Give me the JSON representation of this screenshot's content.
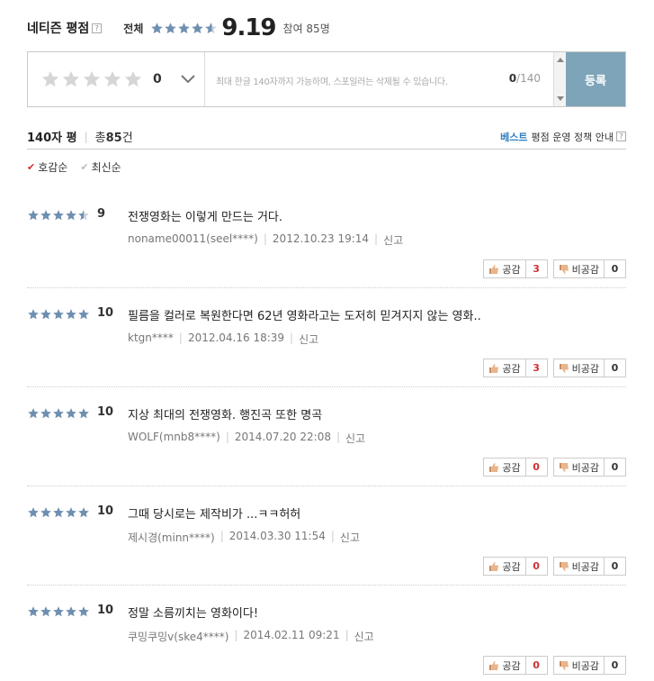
{
  "header": {
    "title": "네티즌 평점",
    "help": "?",
    "overall_label": "전체",
    "overall_stars": 4.6,
    "score": "9.19",
    "participants": "참여 85명"
  },
  "input": {
    "rating_value": "0",
    "placeholder": "최대 한글 140자까지 가능하며, 스포일러는 삭제될 수 있습니다.",
    "count_current": "0",
    "count_max": "/140",
    "submit_label": "등록"
  },
  "info": {
    "type": "140자 평",
    "total_prefix": "총",
    "total_count": "85",
    "total_suffix": "건",
    "best": "베스트",
    "policy": "평점 운영 정책 안내",
    "help": "?"
  },
  "sort": {
    "recommended": "호감순",
    "latest": "최신순"
  },
  "colors": {
    "star_filled": "#6e8fb0",
    "star_empty": "#c8d2dc",
    "submit_bg": "#7da4b8",
    "accent_red": "#d03030",
    "best_blue": "#2e7fc1"
  },
  "reviews": [
    {
      "stars": 4.5,
      "score": "9",
      "text": "전쟁영화는 이렇게 만드는 거다.",
      "author": "noname00011(seel****)",
      "date": "2012.10.23 19:14",
      "report": "신고",
      "like_label": "공감",
      "like_count": "3",
      "dislike_label": "비공감",
      "dislike_count": "0"
    },
    {
      "stars": 5,
      "score": "10",
      "text": "필름을 컬러로 복원한다면 62년 영화라고는 도저히 믿겨지지 않는 영화..",
      "author": "ktgn****",
      "date": "2012.04.16 18:39",
      "report": "신고",
      "like_label": "공감",
      "like_count": "3",
      "dislike_label": "비공감",
      "dislike_count": "0"
    },
    {
      "stars": 5,
      "score": "10",
      "text": "지상 최대의 전쟁영화. 행진곡 또한 명곡",
      "author": "WOLF(mnb8****)",
      "date": "2014.07.20 22:08",
      "report": "신고",
      "like_label": "공감",
      "like_count": "0",
      "dislike_label": "비공감",
      "dislike_count": "0"
    },
    {
      "stars": 5,
      "score": "10",
      "text": "그때 당시로는 제작비가 ...ㅋㅋ허허",
      "author": "제시경(minn****)",
      "date": "2014.03.30 11:54",
      "report": "신고",
      "like_label": "공감",
      "like_count": "0",
      "dislike_label": "비공감",
      "dislike_count": "0"
    },
    {
      "stars": 5,
      "score": "10",
      "text": "정말 소름끼치는 영화이다!",
      "author": "쿠밍쿠밍v(ske4****)",
      "date": "2014.02.11 09:21",
      "report": "신고",
      "like_label": "공감",
      "like_count": "0",
      "dislike_label": "비공감",
      "dislike_count": "0"
    }
  ]
}
